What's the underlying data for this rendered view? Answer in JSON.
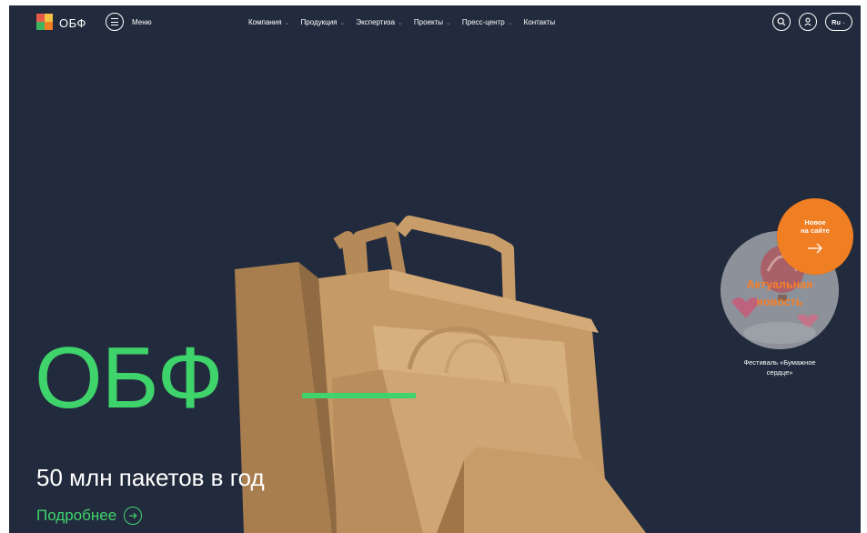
{
  "header": {
    "logo_text": "ОБФ",
    "menu_label": "Меню",
    "nav": [
      {
        "label": "Компания",
        "has_dropdown": true
      },
      {
        "label": "Продукция",
        "has_dropdown": true
      },
      {
        "label": "Экспертиза",
        "has_dropdown": true
      },
      {
        "label": "Проекты",
        "has_dropdown": true
      },
      {
        "label": "Пресс-центр",
        "has_dropdown": true
      },
      {
        "label": "Контакты",
        "has_dropdown": false
      }
    ],
    "icons": [
      "search-icon",
      "user-icon"
    ],
    "lang": "Ru"
  },
  "hero": {
    "title": "ОБФ",
    "subtitle": "50 млн пакетов в год",
    "more_label": "Подробнее"
  },
  "news": {
    "label_line1": "Актуальная",
    "label_line2": "новость",
    "caption_line1": "Фестиваль «Бумажное",
    "caption_line2": "сердце»"
  },
  "new_badge": {
    "line1": "Новое",
    "line2": "на сайте"
  },
  "colors": {
    "background": "#222b3d",
    "accent_green": "#3fd36b",
    "accent_orange": "#f07e22",
    "kraft": "#c69a66"
  }
}
